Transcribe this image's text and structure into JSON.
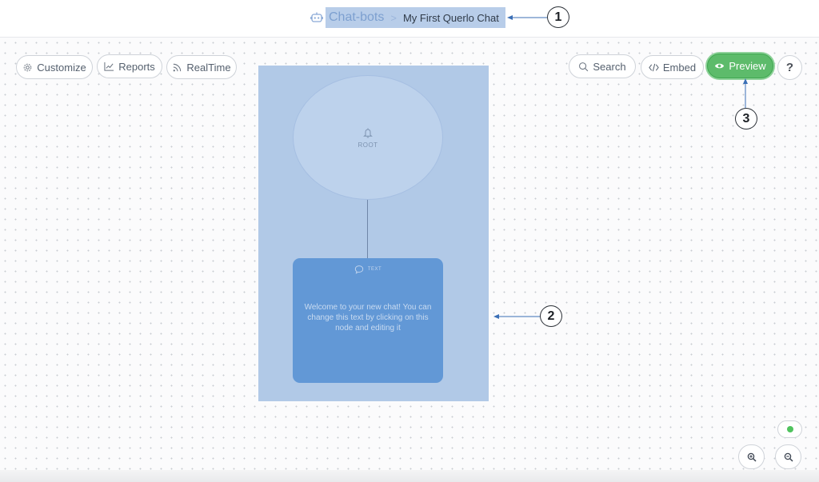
{
  "header": {
    "breadcrumb_root": "Chat-bots",
    "breadcrumb_separator": ">",
    "breadcrumb_current": "My First Querlo Chat"
  },
  "toolbar": {
    "customize_label": "Customize",
    "reports_label": "Reports",
    "realtime_label": "RealTime",
    "search_label": "Search",
    "embed_label": "Embed",
    "preview_label": "Preview",
    "help_label": "?"
  },
  "flow": {
    "root_label": "ROOT",
    "text_node_label": "TEXT",
    "text_node_body": "Welcome to your new chat! You can change this text by clicking on this node and editing it"
  },
  "annotations": {
    "callout_1": "1",
    "callout_2": "2",
    "callout_3": "3"
  },
  "icons": {
    "bot": "robot-icon",
    "customize": "gear-icon",
    "reports": "chart-icon",
    "realtime": "rss-icon",
    "search": "search-icon",
    "embed": "code-icon",
    "preview": "eye-icon",
    "root": "bell-icon",
    "text": "speech-bubble-icon",
    "zoom_in": "zoom-in-icon",
    "zoom_out": "zoom-out-icon"
  },
  "colors": {
    "preview_green": "#5dbb6b",
    "highlight_blue": "#b1c9e7",
    "text_node_blue": "#6298d6",
    "status_green": "#4fc35e"
  }
}
